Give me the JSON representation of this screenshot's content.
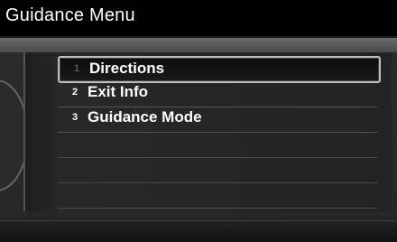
{
  "title": "Guidance Menu",
  "menu": {
    "items": [
      {
        "number": "1",
        "label": "Directions",
        "selected": true
      },
      {
        "number": "2",
        "label": "Exit Info",
        "selected": false
      },
      {
        "number": "3",
        "label": "Guidance Mode",
        "selected": false
      }
    ]
  }
}
